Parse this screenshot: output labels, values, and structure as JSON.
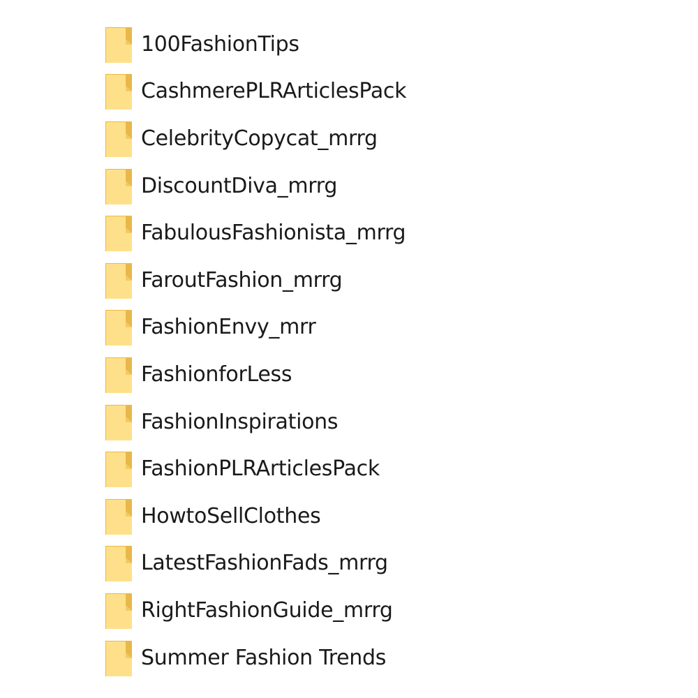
{
  "explorer": {
    "items": [
      {
        "name": "100FashionTips",
        "icon": "folder-icon"
      },
      {
        "name": "CashmerePLRArticlesPack",
        "icon": "folder-icon"
      },
      {
        "name": "CelebrityCopycat_mrrg",
        "icon": "folder-icon"
      },
      {
        "name": "DiscountDiva_mrrg",
        "icon": "folder-icon"
      },
      {
        "name": "FabulousFashionista_mrrg",
        "icon": "folder-icon"
      },
      {
        "name": "FaroutFashion_mrrg",
        "icon": "folder-icon"
      },
      {
        "name": "FashionEnvy_mrr",
        "icon": "folder-icon"
      },
      {
        "name": "FashionforLess",
        "icon": "folder-icon"
      },
      {
        "name": "FashionInspirations",
        "icon": "folder-icon"
      },
      {
        "name": "FashionPLRArticlesPack",
        "icon": "folder-icon"
      },
      {
        "name": "HowtoSellClothes",
        "icon": "folder-icon"
      },
      {
        "name": "LatestFashionFads_mrrg",
        "icon": "folder-icon"
      },
      {
        "name": "RightFashionGuide_mrrg",
        "icon": "folder-icon"
      },
      {
        "name": "Summer Fashion Trends",
        "icon": "folder-icon"
      }
    ]
  },
  "colors": {
    "folder_fill": "#FFE08A",
    "folder_edge": "#E8B84A",
    "text": "#1a1a1a"
  }
}
